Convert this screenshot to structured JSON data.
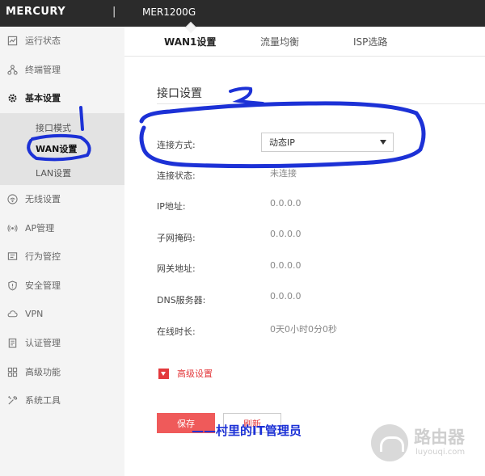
{
  "header": {
    "brand": "MERCURY",
    "divider": "|",
    "model": "MER1200G"
  },
  "sidebar": {
    "items": [
      {
        "label": "运行状态",
        "icon": "status-icon"
      },
      {
        "label": "终端管理",
        "icon": "devices-icon"
      },
      {
        "label": "基本设置",
        "icon": "gear-icon"
      },
      {
        "label": "无线设置",
        "icon": "wifi-icon"
      },
      {
        "label": "AP管理",
        "icon": "ap-icon"
      },
      {
        "label": "行为管控",
        "icon": "behavior-icon"
      },
      {
        "label": "安全管理",
        "icon": "shield-icon"
      },
      {
        "label": "VPN",
        "icon": "cloud-icon"
      },
      {
        "label": "认证管理",
        "icon": "auth-icon"
      },
      {
        "label": "高级功能",
        "icon": "advanced-icon"
      },
      {
        "label": "系统工具",
        "icon": "tools-icon"
      }
    ],
    "submenu": [
      {
        "label": "接口模式"
      },
      {
        "label": "WAN设置"
      },
      {
        "label": "LAN设置"
      }
    ]
  },
  "tabs": [
    {
      "label": "WAN1设置"
    },
    {
      "label": "流量均衡"
    },
    {
      "label": "ISP选路"
    }
  ],
  "main": {
    "section_title": "接口设置",
    "connection_type_label": "连接方式:",
    "connection_type_value": "动态IP",
    "fields": [
      {
        "label": "连接状态:",
        "value": "未连接"
      },
      {
        "label": "IP地址:",
        "value": "0.0.0.0"
      },
      {
        "label": "子网掩码:",
        "value": "0.0.0.0"
      },
      {
        "label": "网关地址:",
        "value": "0.0.0.0"
      },
      {
        "label": "DNS服务器:",
        "value": "0.0.0.0"
      },
      {
        "label": "在线时长:",
        "value": "0天0小时0分0秒"
      }
    ],
    "advanced_label": "高级设置",
    "save_label": "保存",
    "refresh_label": "刷新"
  },
  "watermark": {
    "caption": "——村里的IT管理员",
    "site_name": "路由器",
    "site_url": "luyouqi.com"
  },
  "colors": {
    "topbar": "#2b2b2b",
    "accent": "#e3393c",
    "annotation": "#1c31d6"
  }
}
